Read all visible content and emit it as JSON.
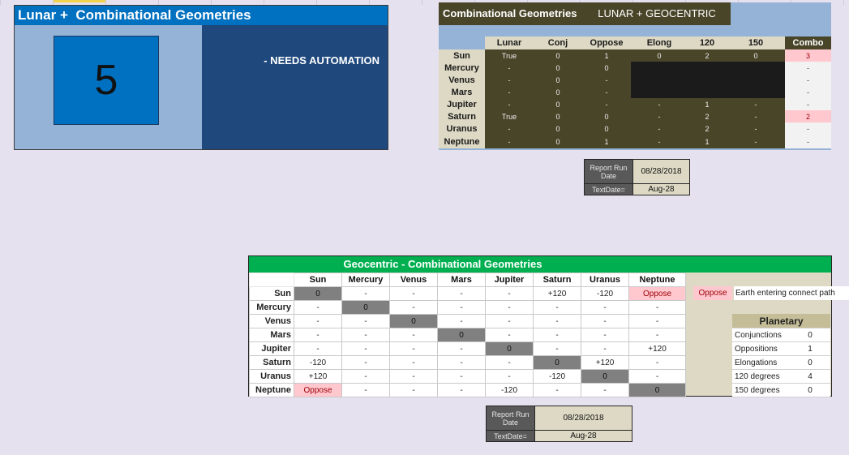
{
  "lunar_panel": {
    "title": "Lunar +  Combinational Geometries",
    "count": "5",
    "note": "- NEEDS AUTOMATION"
  },
  "lunar_geo_panel": {
    "title_left": "Combinational Geometries",
    "title_right": "LUNAR + GEOCENTRIC",
    "columns": [
      "Lunar",
      "Conj",
      "Oppose",
      "Elong",
      "120",
      "150",
      "Combo"
    ],
    "rows": [
      {
        "label": "Sun",
        "cells": [
          "True",
          "0",
          "1",
          "0",
          "2",
          "0"
        ],
        "combo": "3"
      },
      {
        "label": "Mercury",
        "cells": [
          "-",
          "0",
          "0",
          "",
          "",
          ""
        ],
        "combo": "-"
      },
      {
        "label": "Venus",
        "cells": [
          "-",
          "0",
          "-",
          "",
          "",
          ""
        ],
        "combo": "-"
      },
      {
        "label": "Mars",
        "cells": [
          "-",
          "0",
          "-",
          "",
          "",
          ""
        ],
        "combo": "-"
      },
      {
        "label": "Jupiter",
        "cells": [
          "-",
          "0",
          "-",
          "-",
          "1",
          "-"
        ],
        "combo": "-"
      },
      {
        "label": "Saturn",
        "cells": [
          "True",
          "0",
          "0",
          "-",
          "2",
          "-"
        ],
        "combo": "2"
      },
      {
        "label": "Uranus",
        "cells": [
          "-",
          "0",
          "0",
          "-",
          "2",
          "-"
        ],
        "combo": "-"
      },
      {
        "label": "Neptune",
        "cells": [
          "-",
          "0",
          "1",
          "-",
          "1",
          "-"
        ],
        "combo": "-"
      }
    ]
  },
  "report_top": {
    "run_label": "Report Run Date",
    "run_value": "08/28/2018",
    "text_label": "TextDate=",
    "text_value": "Aug-28"
  },
  "geocentric_panel": {
    "title": "Geocentric - Combinational Geometries",
    "columns": [
      "Sun",
      "Mercury",
      "Venus",
      "Mars",
      "Jupiter",
      "Saturn",
      "Uranus",
      "Neptune"
    ],
    "rows": [
      {
        "label": "Sun",
        "cells": [
          "0",
          "-",
          "-",
          "-",
          "-",
          "+120",
          "-120",
          "Oppose"
        ]
      },
      {
        "label": "Mercury",
        "cells": [
          "-",
          "0",
          "-",
          "-",
          "-",
          "-",
          "-",
          "-"
        ]
      },
      {
        "label": "Venus",
        "cells": [
          "-",
          "-",
          "0",
          "-",
          "-",
          "-",
          "-",
          "-"
        ]
      },
      {
        "label": "Mars",
        "cells": [
          "-",
          "-",
          "-",
          "0",
          "-",
          "-",
          "-",
          "-"
        ]
      },
      {
        "label": "Jupiter",
        "cells": [
          "-",
          "-",
          "-",
          "-",
          "0",
          "-",
          "-",
          "+120"
        ]
      },
      {
        "label": "Saturn",
        "cells": [
          "-120",
          "-",
          "-",
          "-",
          "-",
          "0",
          "+120",
          "-"
        ]
      },
      {
        "label": "Uranus",
        "cells": [
          "+120",
          "-",
          "-",
          "-",
          "-",
          "-120",
          "0",
          "-"
        ]
      },
      {
        "label": "Neptune",
        "cells": [
          "Oppose",
          "-",
          "-",
          "-",
          "-120",
          "-",
          "-",
          "0"
        ]
      }
    ],
    "oppose_flag": "Oppose",
    "oppose_note": "Earth entering connect path",
    "planetary": {
      "header": "Planetary",
      "items": [
        {
          "label": "Conjunctions",
          "value": "0"
        },
        {
          "label": "Oppositions",
          "value": "1"
        },
        {
          "label": "Elongations",
          "value": "0"
        },
        {
          "label": "120 degrees",
          "value": "4"
        },
        {
          "label": "150 degrees",
          "value": "0"
        }
      ]
    }
  },
  "report_bottom": {
    "run_label": "Report Run Date",
    "run_value": "08/28/2018",
    "text_label": "TextDate=",
    "text_value": "Aug-28"
  },
  "colors": {
    "lunar_title": "#0070c0",
    "lunar_right": "#1f497d",
    "olive": "#494529",
    "tan": "#ddd9c4",
    "green_title": "#00b050",
    "pink": "#ffc7ce",
    "diagonal": "#808080"
  }
}
